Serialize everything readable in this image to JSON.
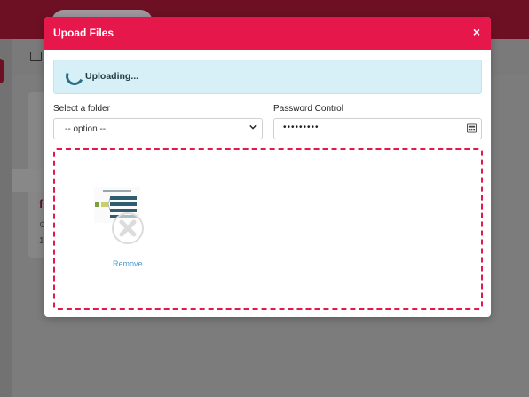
{
  "modal": {
    "title": "Upoad Files",
    "close_label": "×",
    "status": {
      "text": "Uploading..."
    },
    "folder": {
      "label": "Select a folder",
      "selected": "-- option --"
    },
    "password": {
      "label": "Password Control",
      "value": "•••••••••"
    },
    "dropzone": {
      "remove_label": "Remove"
    }
  },
  "colors": {
    "header": "#e5174b",
    "alert_bg": "#d7eff6",
    "dropzone_border": "#e5174b",
    "link": "#4a9ad0"
  },
  "background_app": {
    "text_fragments": [
      "f",
      "⊙",
      "1"
    ]
  }
}
